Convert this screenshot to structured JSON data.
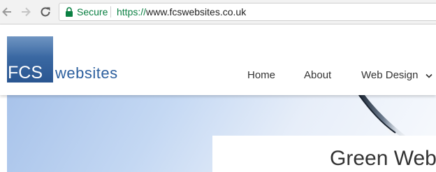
{
  "browser": {
    "secure_label": "Secure",
    "url_scheme": "https://",
    "url_host": "www.fcswebsites.co.uk",
    "secure_color": "#0b8043"
  },
  "logo": {
    "part1": "FCS",
    "part2": "websites",
    "brand_color": "#2c5f9e"
  },
  "menu": {
    "items": [
      {
        "label": "Home"
      },
      {
        "label": "About"
      },
      {
        "label": "Web Design",
        "icon": "chevron-down-icon"
      }
    ]
  },
  "hero": {
    "title": "Green Web"
  },
  "icons": [
    "back-arrow-icon",
    "forward-arrow-icon",
    "reload-icon",
    "lock-icon",
    "chevron-down-icon"
  ]
}
